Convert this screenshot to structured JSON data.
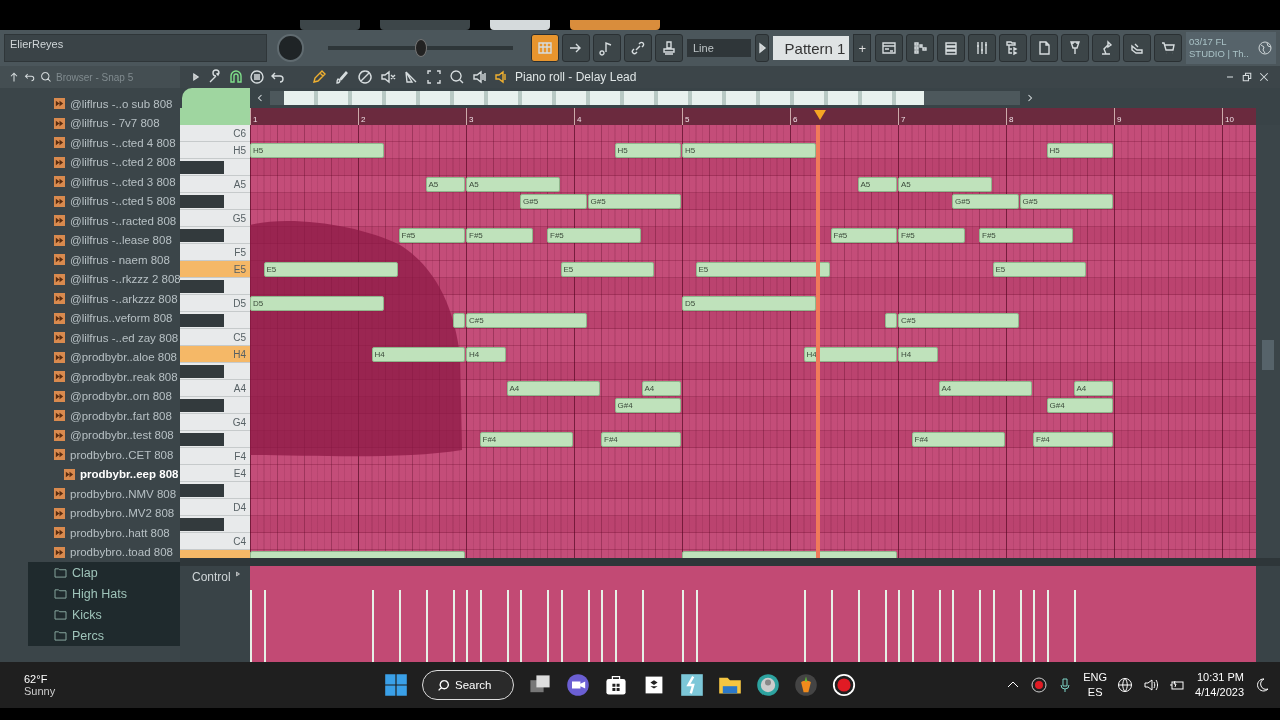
{
  "toolbar": {
    "hint_bar": "ElierReyes",
    "view_buttons": [
      {
        "kind": "pianoroll",
        "on": true
      },
      {
        "kind": "arrow",
        "on": false
      },
      {
        "kind": "note",
        "on": false
      },
      {
        "kind": "link",
        "on": false
      },
      {
        "kind": "stamp",
        "on": false
      }
    ],
    "master_pitch": {
      "level": 0.5
    },
    "line_mode": "Line",
    "pattern": "Pattern 1",
    "plus": "+",
    "window_buttons": [
      {
        "kind": "playlist"
      },
      {
        "kind": "piano"
      },
      {
        "kind": "list"
      },
      {
        "kind": "sliders"
      },
      {
        "kind": "tree"
      },
      {
        "kind": "document"
      },
      {
        "kind": "plug"
      },
      {
        "kind": "lamp"
      },
      {
        "kind": "hand"
      },
      {
        "kind": "cart"
      }
    ],
    "news": "03/17 FL STUDIO | Th.."
  },
  "browser": {
    "title": "Browser - Snap 5",
    "items": [
      {
        "label": "@liflrus -..o sub 808",
        "kind": "sample",
        "selected": false
      },
      {
        "label": "@lilfrus - 7v7 808",
        "kind": "sample",
        "selected": false
      },
      {
        "label": "@lilfrus -..cted 4 808",
        "kind": "sample",
        "selected": false
      },
      {
        "label": "@lilfrus -..cted 2 808",
        "kind": "sample",
        "selected": false
      },
      {
        "label": "@lilfrus -..cted 3 808",
        "kind": "sample",
        "selected": false
      },
      {
        "label": "@lilfrus -..cted 5 808",
        "kind": "sample",
        "selected": false
      },
      {
        "label": "@lilfrus -..racted 808",
        "kind": "sample",
        "selected": false
      },
      {
        "label": "@lilfrus -..lease 808",
        "kind": "sample",
        "selected": false
      },
      {
        "label": "@lilfrus - naem 808",
        "kind": "sample",
        "selected": false
      },
      {
        "label": "@lilfrus -..rkzzz 2 808",
        "kind": "sample",
        "selected": false
      },
      {
        "label": "@lilfrus -..arkzzz 808",
        "kind": "sample",
        "selected": false
      },
      {
        "label": "@lilfrus..veform 808",
        "kind": "sample",
        "selected": false
      },
      {
        "label": "@lilfrus -..ed zay 808",
        "kind": "sample",
        "selected": false
      },
      {
        "label": "@prodbybr..aloe 808",
        "kind": "sample",
        "selected": false
      },
      {
        "label": "@prodbybr..reak 808",
        "kind": "sample",
        "selected": false
      },
      {
        "label": "@prodbybr..orn 808",
        "kind": "sample",
        "selected": false
      },
      {
        "label": "@prodbybr..fart 808",
        "kind": "sample",
        "selected": false
      },
      {
        "label": "@prodbybr..test 808",
        "kind": "sample",
        "selected": false
      },
      {
        "label": "prodbybro..CET 808",
        "kind": "sample",
        "selected": false
      },
      {
        "label": "prodbybr..eep 808",
        "kind": "sample",
        "selected": true
      },
      {
        "label": "prodbybro..NMV 808",
        "kind": "sample",
        "selected": false
      },
      {
        "label": "prodbybro..MV2 808",
        "kind": "sample",
        "selected": false
      },
      {
        "label": "prodbybro..hatt 808",
        "kind": "sample",
        "selected": false
      },
      {
        "label": "prodbybro..toad 808",
        "kind": "sample",
        "selected": false
      },
      {
        "label": "Clap",
        "kind": "folder",
        "selected": false
      },
      {
        "label": "High Hats",
        "kind": "folder",
        "selected": false
      },
      {
        "label": "Kicks",
        "kind": "folder",
        "selected": false
      },
      {
        "label": "Percs",
        "kind": "folder",
        "selected": false
      }
    ]
  },
  "piano_roll": {
    "title": "Piano roll - Delay Lead",
    "snap_on": true,
    "tools": [
      {
        "kind": "pencil",
        "selected": true
      },
      {
        "kind": "brush",
        "selected": false
      },
      {
        "kind": "ban",
        "selected": false
      },
      {
        "kind": "mute",
        "selected": false
      },
      {
        "kind": "knife",
        "selected": false
      },
      {
        "kind": "select",
        "selected": false
      },
      {
        "kind": "zoom",
        "selected": false
      },
      {
        "kind": "speaker",
        "selected": false
      }
    ],
    "ruler": [
      "1",
      "2",
      "3",
      "4",
      "5",
      "6",
      "7",
      "8",
      "9",
      "10"
    ],
    "keys": [
      {
        "label": "C6",
        "black": false,
        "highlighted": false
      },
      {
        "label": "H5",
        "black": false,
        "highlighted": false
      },
      {
        "black": true,
        "highlighted": false
      },
      {
        "label": "A5",
        "black": false,
        "highlighted": false
      },
      {
        "black": true,
        "highlighted": false
      },
      {
        "label": "G5",
        "black": false,
        "highlighted": false
      },
      {
        "black": true,
        "highlighted": false
      },
      {
        "label": "F5",
        "black": false,
        "highlighted": false
      },
      {
        "label": "E5",
        "black": false,
        "highlighted": true
      },
      {
        "black": true,
        "highlighted": false
      },
      {
        "label": "D5",
        "black": false,
        "highlighted": false
      },
      {
        "black": true,
        "highlighted": false
      },
      {
        "label": "C5",
        "black": false,
        "highlighted": false
      },
      {
        "label": "H4",
        "black": false,
        "highlighted": true
      },
      {
        "black": true,
        "highlighted": false
      },
      {
        "label": "A4",
        "black": false,
        "highlighted": false
      },
      {
        "black": true,
        "highlighted": false
      },
      {
        "label": "G4",
        "black": false,
        "highlighted": false
      },
      {
        "black": true,
        "highlighted": false
      },
      {
        "label": "F4",
        "black": false,
        "highlighted": false
      },
      {
        "label": "E4",
        "black": false,
        "highlighted": false
      },
      {
        "black": true,
        "highlighted": false
      },
      {
        "label": "D4",
        "black": false,
        "highlighted": false
      },
      {
        "black": true,
        "highlighted": false
      },
      {
        "label": "C4",
        "black": false,
        "highlighted": false
      },
      {
        "black": false,
        "highlighted": true
      }
    ],
    "notes": [
      {
        "label": "H5"
      },
      {
        "label": "H5"
      },
      {
        "label": "H5"
      },
      {
        "label": "H5"
      },
      {
        "label": "A5"
      },
      {
        "label": "A5"
      },
      {
        "label": "A5"
      },
      {
        "label": "A5"
      },
      {
        "label": "G#5"
      },
      {
        "label": "G#5"
      },
      {
        "label": "G#5"
      },
      {
        "label": "G#5"
      },
      {
        "label": "F#5"
      },
      {
        "label": "F#5"
      },
      {
        "label": "F#5"
      },
      {
        "label": "F#5"
      },
      {
        "label": "F#5"
      },
      {
        "label": "F#5"
      },
      {
        "label": "E5"
      },
      {
        "label": "E5"
      },
      {
        "label": "E5"
      },
      {
        "label": "E5"
      },
      {
        "label": "D5"
      },
      {
        "label": "D5"
      },
      {
        "label": "C#5"
      },
      {
        "label": "C#5"
      },
      {
        "label": "H4"
      },
      {
        "label": "H4"
      },
      {
        "label": "H4"
      },
      {
        "label": "H4"
      },
      {
        "label": "A4"
      },
      {
        "label": "A4"
      },
      {
        "label": "A4"
      },
      {
        "label": "A4"
      },
      {
        "label": "G#4"
      },
      {
        "label": "G#4"
      },
      {
        "label": "F#4"
      },
      {
        "label": "F#4"
      },
      {
        "label": "F#4"
      },
      {
        "label": "F#4"
      }
    ],
    "control_label": "Control"
  },
  "taskbar": {
    "temperature": "62°F",
    "weather": "Sunny",
    "search": "Search",
    "language": "ENG",
    "layout": "ES",
    "time": "10:31 PM",
    "date": "4/14/2023"
  }
}
